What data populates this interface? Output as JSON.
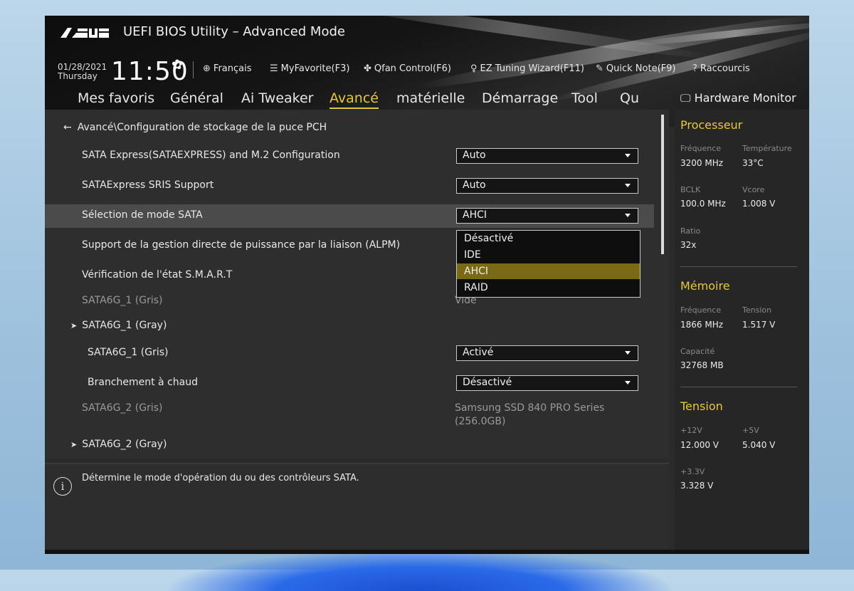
{
  "header": {
    "title": "UEFI BIOS Utility – Advanced Mode",
    "date": "01/28/2021",
    "day": "Thursday",
    "time": "11:50",
    "toolbar": {
      "language": "Français",
      "myfavorite": "MyFavorite(F3)",
      "qfan": "Qfan Control(F6)",
      "ez_tuning": "EZ Tuning Wizard(F11)",
      "quick_note": "Quick Note(F9)",
      "shortcuts": "Raccourcis"
    }
  },
  "nav": {
    "tabs": [
      "Mes favoris",
      "Général",
      "Ai Tweaker",
      "Avancé",
      "matérielle",
      "Démarrage",
      "Tool",
      "Qu"
    ],
    "active": "Avancé"
  },
  "main": {
    "breadcrumb": "Avancé\\Configuration de stockage de la puce PCH",
    "rows": {
      "sata_express_label": "SATA Express(SATAEXPRESS) and M.2 Configuration",
      "sata_express_value": "Auto",
      "sris_label": "SATAExpress SRIS Support",
      "sris_value": "Auto",
      "sata_mode_label": "Sélection de mode SATA",
      "sata_mode_value": "AHCI",
      "alpm_label": "Support de la gestion directe de puissance par la liaison (ALPM)",
      "smart_label": "Vérification de l'état S.M.A.R.T",
      "sata6g1_gris_label": "SATA6G_1 (Gris)",
      "sata6g1_gris_value": "Vide",
      "sata6g1_gray_label": "SATA6G_1 (Gray)",
      "sata6g1_sub_label": "SATA6G_1 (Gris)",
      "sata6g1_sub_value": "Activé",
      "hotplug_label": "Branchement à chaud",
      "hotplug_value": "Désactivé",
      "sata6g2_gris_label": "SATA6G_2 (Gris)",
      "sata6g2_device_line1": "Samsung SSD 840 PRO Series",
      "sata6g2_device_line2": "(256.0GB)",
      "sata6g2_gray_label": "SATA6G_2 (Gray)"
    },
    "dropdown": {
      "options": [
        "Désactivé",
        "IDE",
        "AHCI",
        "RAID"
      ],
      "selected": "AHCI"
    }
  },
  "info": {
    "text": "Détermine le mode d'opération du ou des contrôleurs SATA."
  },
  "hardware_monitor": {
    "title": "Hardware Monitor",
    "processeur": {
      "heading": "Processeur",
      "freq_label": "Fréquence",
      "freq_value": "3200 MHz",
      "temp_label": "Température",
      "temp_value": "33°C",
      "bclk_label": "BCLK",
      "bclk_value": "100.0 MHz",
      "vcore_label": "Vcore",
      "vcore_value": "1.008 V",
      "ratio_label": "Ratio",
      "ratio_value": "32x"
    },
    "memoire": {
      "heading": "Mémoire",
      "freq_label": "Fréquence",
      "freq_value": "1866 MHz",
      "tension_label": "Tension",
      "tension_value": "1.517 V",
      "cap_label": "Capacité",
      "cap_value": "32768 MB"
    },
    "tension": {
      "heading": "Tension",
      "v12_label": "+12V",
      "v12_value": "12.000 V",
      "v5_label": "+5V",
      "v5_value": "5.040 V",
      "v33_label": "+3.3V",
      "v33_value": "3.328 V"
    }
  },
  "colors": {
    "accent": "#e8c83a",
    "selected_option": "#7a6a14",
    "panel": "#2e2e2e",
    "highlight_row": "#4b4b4b"
  }
}
